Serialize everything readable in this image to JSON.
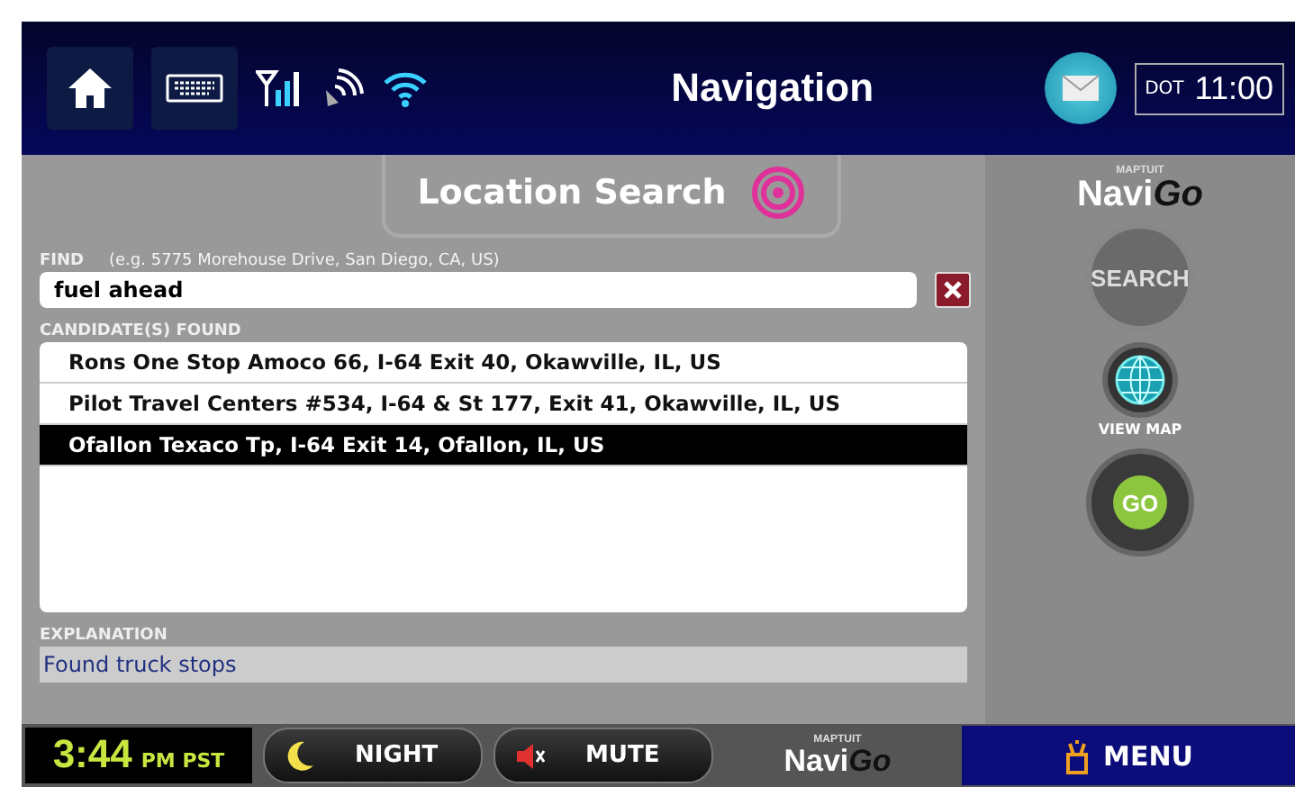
{
  "header": {
    "title": "Navigation",
    "dot_label": "DOT",
    "dot_time": "11:00"
  },
  "panel": {
    "title": "Location Search"
  },
  "logo": {
    "maker": "MAPTUIT",
    "navi": "Navi",
    "go": "Go"
  },
  "find": {
    "label": "FIND",
    "hint": "(e.g. 5775 Morehouse Drive, San Diego, CA, US)",
    "value": "fuel ahead"
  },
  "candidates": {
    "label": "CANDIDATE(S) FOUND",
    "rows": [
      {
        "text": "Rons One Stop Amoco 66, I-64 Exit 40, Okawville, IL, US",
        "selected": false
      },
      {
        "text": "Pilot Travel Centers #534, I-64 & St 177, Exit 41, Okawville, IL, US",
        "selected": false
      },
      {
        "text": "Ofallon Texaco Tp, I-64 Exit 14, Ofallon, IL, US",
        "selected": true
      }
    ]
  },
  "explanation": {
    "label": "EXPLANATION",
    "text": "Found truck stops"
  },
  "side": {
    "search": {
      "label": "SEARCH",
      "disabled": true
    },
    "view_map": "VIEW MAP",
    "go": "GO"
  },
  "bottom": {
    "time": "3:44",
    "zone": "PM PST",
    "night": "NIGHT",
    "mute": "MUTE",
    "logo": {
      "maker": "MAPTUIT",
      "navi": "Navi",
      "go": "Go"
    },
    "menu": "MENU"
  }
}
